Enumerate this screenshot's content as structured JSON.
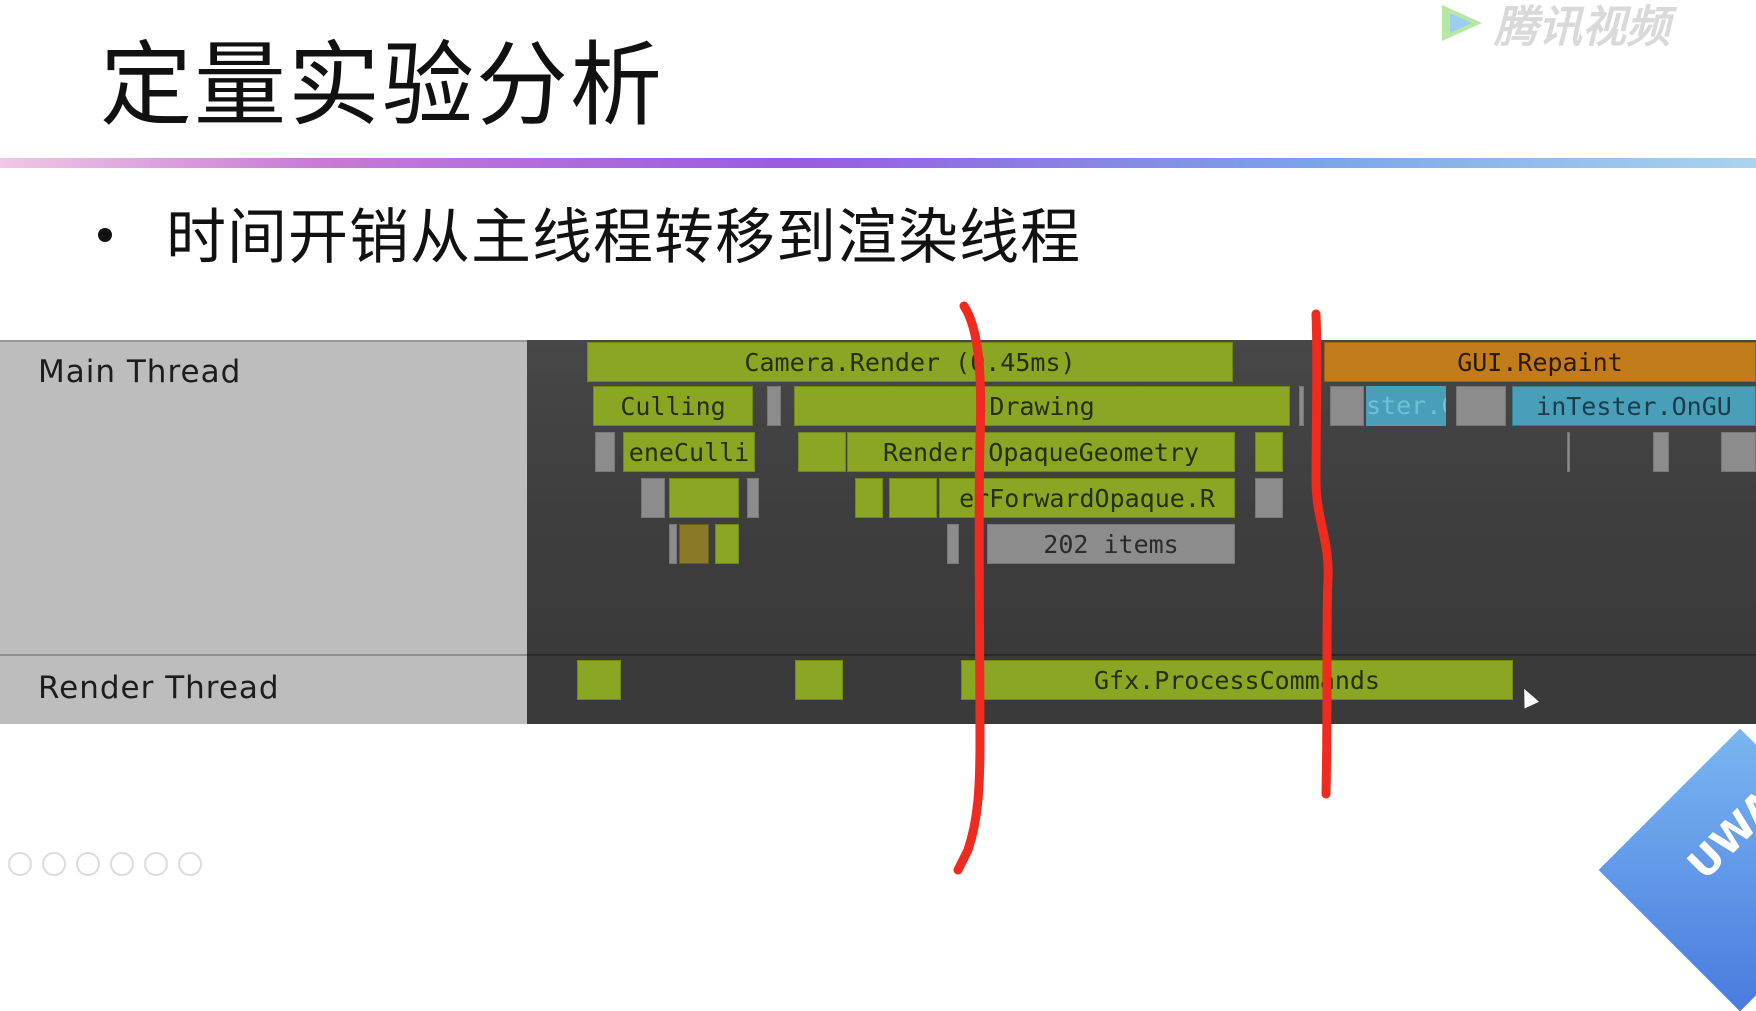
{
  "slide": {
    "title": "定量实验分析",
    "bullet": "时间开销从主线程转移到渲染线程",
    "watermark": "腾讯视频",
    "corner_badge": "UWA"
  },
  "profiler": {
    "main_thread_label": "Main Thread",
    "render_thread_label": "Render Thread",
    "blocks": {
      "camera_render": "Camera.Render (0.45ms)",
      "gui_repaint": "GUI.Repaint",
      "culling": "Culling",
      "drawing": "Drawing",
      "scene_culling": "eneCulli",
      "render_opaque": "Render.OpaqueGeometry",
      "forward_opaque": "erForwardOpaque.R",
      "items": "202 items",
      "tester_left": "ster.C",
      "tester_ongui": "inTester.OnGU",
      "gfx_process": "Gfx.ProcessCommands"
    }
  },
  "colors": {
    "green_block": "#8aa622",
    "orange_block": "#c27c19",
    "blue_block": "#4a9fb8",
    "grey_block": "#8c8c8c",
    "annotation_red": "#ef2a1e"
  }
}
